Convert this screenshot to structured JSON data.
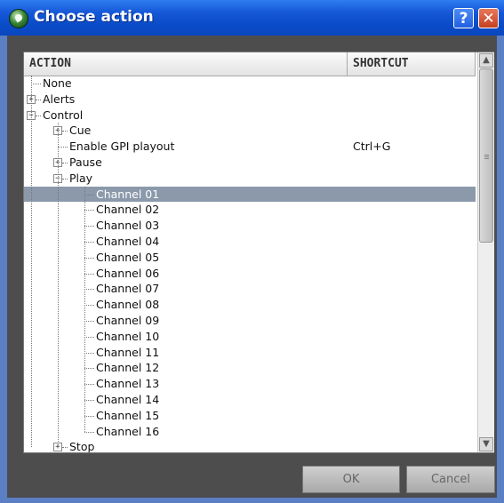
{
  "window": {
    "title": "Choose action"
  },
  "titlebar": {
    "help_label": "?",
    "close_label": "✕"
  },
  "list": {
    "columns": {
      "action": "ACTION",
      "shortcut": "SHORTCUT"
    },
    "rows": [
      {
        "label": "None",
        "depth": 0,
        "expander": "none",
        "shortcut": ""
      },
      {
        "label": "Alerts",
        "depth": 0,
        "expander": "+",
        "shortcut": ""
      },
      {
        "label": "Control",
        "depth": 0,
        "expander": "-",
        "shortcut": ""
      },
      {
        "label": "Cue",
        "depth": 1,
        "expander": "+",
        "shortcut": ""
      },
      {
        "label": "Enable GPI playout",
        "depth": 1,
        "expander": "none",
        "shortcut": "Ctrl+G"
      },
      {
        "label": "Pause",
        "depth": 1,
        "expander": "+",
        "shortcut": ""
      },
      {
        "label": "Play",
        "depth": 1,
        "expander": "-",
        "shortcut": ""
      },
      {
        "label": "Channel 01",
        "depth": 2,
        "expander": "none",
        "shortcut": "",
        "selected": true
      },
      {
        "label": "Channel 02",
        "depth": 2,
        "expander": "none",
        "shortcut": ""
      },
      {
        "label": "Channel 03",
        "depth": 2,
        "expander": "none",
        "shortcut": ""
      },
      {
        "label": "Channel 04",
        "depth": 2,
        "expander": "none",
        "shortcut": ""
      },
      {
        "label": "Channel 05",
        "depth": 2,
        "expander": "none",
        "shortcut": ""
      },
      {
        "label": "Channel 06",
        "depth": 2,
        "expander": "none",
        "shortcut": ""
      },
      {
        "label": "Channel 07",
        "depth": 2,
        "expander": "none",
        "shortcut": ""
      },
      {
        "label": "Channel 08",
        "depth": 2,
        "expander": "none",
        "shortcut": ""
      },
      {
        "label": "Channel 09",
        "depth": 2,
        "expander": "none",
        "shortcut": ""
      },
      {
        "label": "Channel 10",
        "depth": 2,
        "expander": "none",
        "shortcut": ""
      },
      {
        "label": "Channel 11",
        "depth": 2,
        "expander": "none",
        "shortcut": ""
      },
      {
        "label": "Channel 12",
        "depth": 2,
        "expander": "none",
        "shortcut": ""
      },
      {
        "label": "Channel 13",
        "depth": 2,
        "expander": "none",
        "shortcut": ""
      },
      {
        "label": "Channel 14",
        "depth": 2,
        "expander": "none",
        "shortcut": ""
      },
      {
        "label": "Channel 15",
        "depth": 2,
        "expander": "none",
        "shortcut": ""
      },
      {
        "label": "Channel 16",
        "depth": 2,
        "expander": "none",
        "shortcut": ""
      },
      {
        "label": "Stop",
        "depth": 1,
        "expander": "+",
        "shortcut": ""
      }
    ]
  },
  "buttons": {
    "ok": "OK",
    "cancel": "Cancel"
  },
  "colors": {
    "selection": "#8b99ab",
    "titlebar": "#0a4bc7",
    "client_bg": "#4d4d4d"
  }
}
